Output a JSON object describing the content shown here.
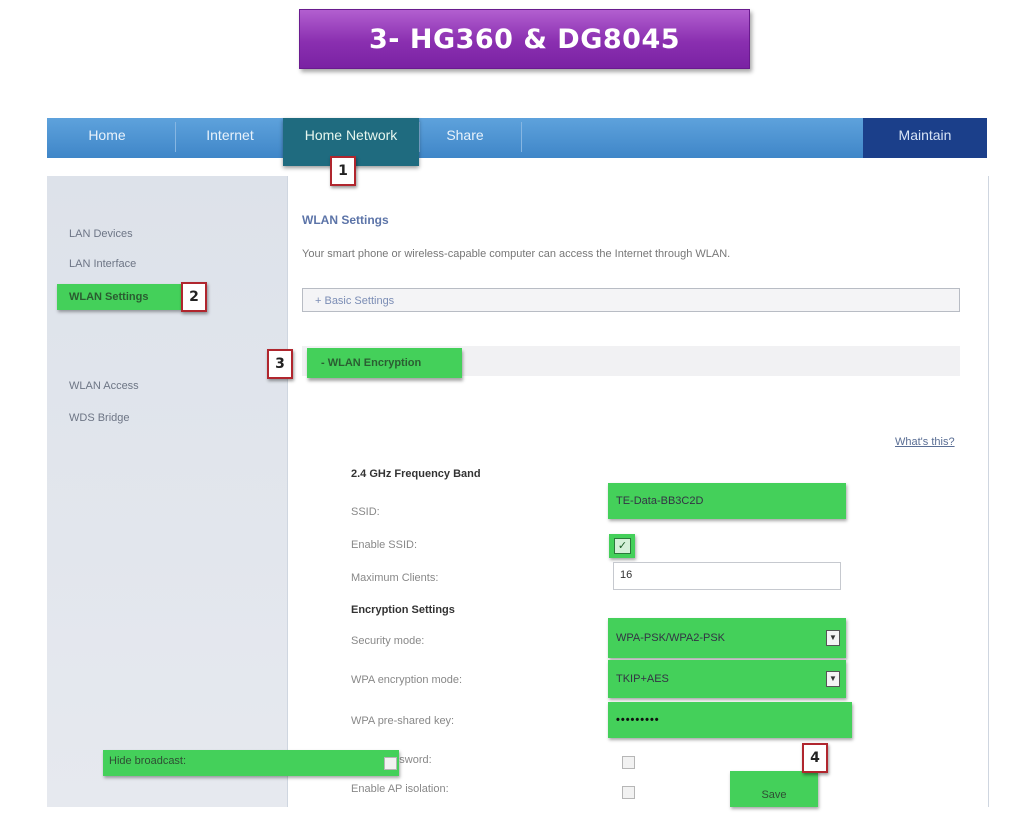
{
  "banner": {
    "title": "3- HG360 & DG8045"
  },
  "topnav": {
    "items": [
      "Home",
      "Internet",
      "Home Network",
      "Share"
    ],
    "right_item": "Maintain"
  },
  "sidebar": {
    "items": [
      "LAN Devices",
      "LAN Interface",
      "WLAN Settings",
      "WLAN Access",
      "WDS Bridge"
    ],
    "active_index": 2
  },
  "content": {
    "title": "WLAN Settings",
    "description": "Your smart phone or wireless-capable computer can access the Internet through WLAN.",
    "basic_settings": "+ Basic Settings",
    "wlan_encryption": "- WLAN Encryption",
    "whats_this": "What's this?"
  },
  "form": {
    "band_title": "2.4 GHz Frequency Band",
    "ssid_label": "SSID:",
    "ssid_value": "TE-Data-BB3C2D",
    "enable_ssid_label": "Enable SSID:",
    "enable_ssid_checked": true,
    "max_clients_label": "Maximum Clients:",
    "max_clients_value": "16",
    "encryption_title": "Encryption Settings",
    "security_mode_label": "Security mode:",
    "security_mode_value": "WPA-PSK/WPA2-PSK",
    "wpa_mode_label": "WPA encryption mode:",
    "wpa_mode_value": "TKIP+AES",
    "psk_label": "WPA pre-shared key:",
    "psk_value": "•••••••••",
    "show_password_label": "Show password:",
    "ap_isolation_label": "Enable AP isolation:",
    "hide_broadcast_label": "Hide broadcast:",
    "save_label": "Save"
  },
  "steps": [
    "1",
    "2",
    "3",
    "4"
  ],
  "colors": {
    "highlight": "#44d05a",
    "nav_blue": "#3f86c8",
    "banner_purple": "#8a2fb0",
    "badge_border": "#b0262e"
  }
}
